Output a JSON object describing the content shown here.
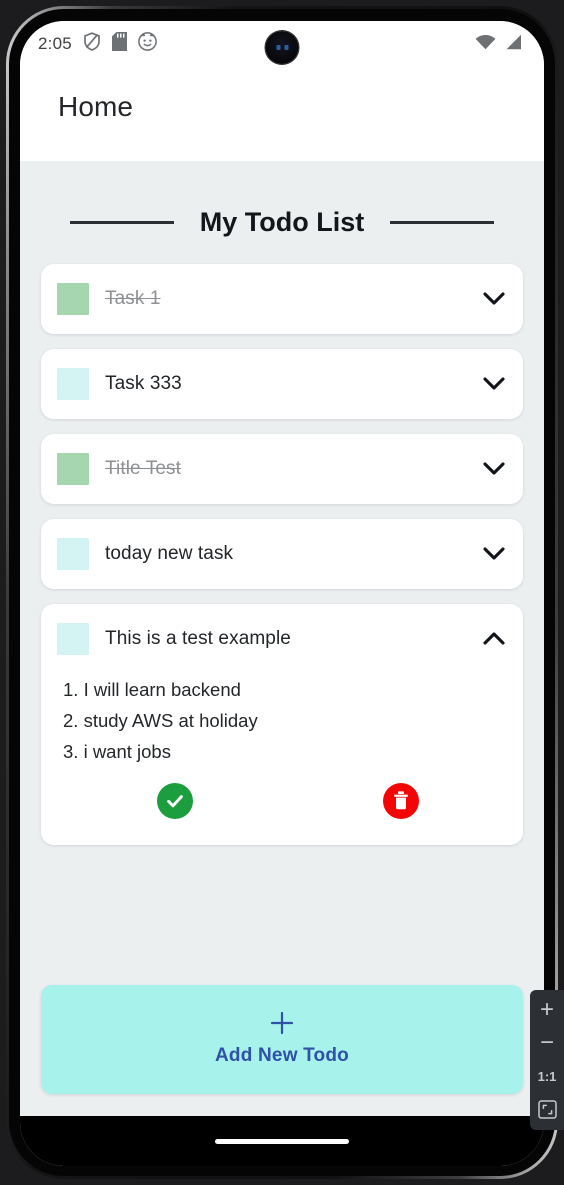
{
  "status_bar": {
    "time": "2:05",
    "left_icons": [
      "shield-icon",
      "sd-card-icon",
      "face-icon"
    ],
    "right_icons": [
      "wifi-icon",
      "cellular-signal-icon"
    ]
  },
  "app_bar": {
    "title": "Home"
  },
  "list_header": {
    "title": "My Todo List"
  },
  "todos": [
    {
      "title": "Task 1",
      "completed": true,
      "expanded": false,
      "chevron": "chevron-down-icon"
    },
    {
      "title": "Task 333",
      "completed": false,
      "expanded": false,
      "chevron": "chevron-down-icon"
    },
    {
      "title": "Title Test",
      "completed": true,
      "expanded": false,
      "chevron": "chevron-down-icon"
    },
    {
      "title": "today new task",
      "completed": false,
      "expanded": false,
      "chevron": "chevron-down-icon"
    },
    {
      "title": "This is a test example",
      "completed": false,
      "expanded": true,
      "chevron": "chevron-up-icon",
      "lines": [
        "1. I will learn backend",
        "2. study AWS at holiday",
        "3. i want jobs"
      ],
      "actions": {
        "complete_icon": "check-circle-icon",
        "delete_icon": "trash-circle-icon"
      }
    }
  ],
  "add_button": {
    "icon": "plus-icon",
    "label": "Add New Todo"
  },
  "zoom_toolbar": {
    "zoom_in": "+",
    "zoom_out": "−",
    "actual_size": "1:1",
    "fit_icon": "fit-to-screen-icon"
  },
  "colors": {
    "background": "#ebeff0",
    "card": "#ffffff",
    "swatch_done": "#a5d6b0",
    "swatch_active": "#d3f4f2",
    "add_button_bg": "#a8f2ec",
    "add_button_text": "#2f51a6",
    "complete_green": "#1c9e3f",
    "delete_red": "#f50606"
  }
}
